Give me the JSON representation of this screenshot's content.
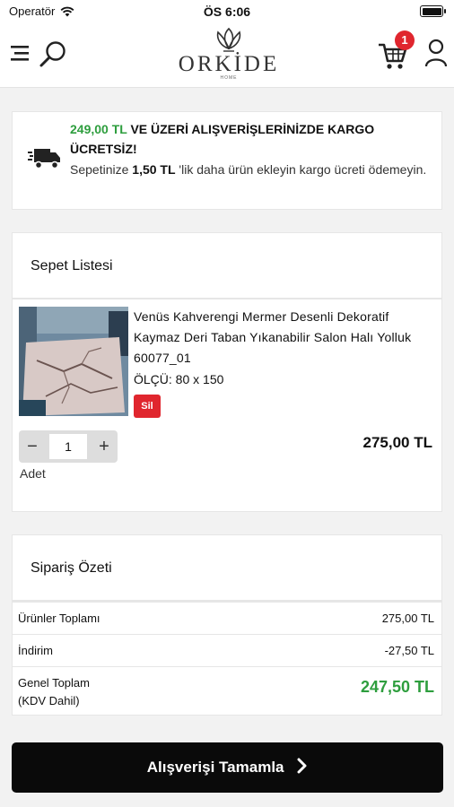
{
  "status_bar": {
    "carrier": "Operatör",
    "time": "ÖS 6:06"
  },
  "header": {
    "logo_text": "ORKİDE",
    "logo_subtext": "HOME",
    "cart_count": "1"
  },
  "shipping_banner": {
    "threshold": "249,00 TL",
    "title_rest": "VE ÜZERİ ALIŞVERİŞLERİNİZDE KARGO ÜCRETSİZ!",
    "message_prefix": "Sepetinize",
    "remaining_amount": "1,50 TL",
    "message_suffix": "'lik daha ürün ekleyin kargo ücreti ödemeyin."
  },
  "cart": {
    "title": "Sepet Listesi",
    "items": [
      {
        "name": "Venüs Kahverengi Mermer Desenli Dekoratif Kaymaz Deri Taban Yıkanabilir Salon Halı Yolluk 60077_01",
        "size": "ÖLÇÜ: 80 x 150",
        "remove_label": "Sil",
        "quantity": "1",
        "quantity_label": "Adet",
        "price": "275,00 TL"
      }
    ]
  },
  "summary": {
    "title": "Sipariş Özeti",
    "products_total_label": "Ürünler Toplamı",
    "products_total_value": "275,00 TL",
    "discount_label": "İndirim",
    "discount_value": "-27,50 TL",
    "grand_total_label_line1": "Genel Toplam",
    "grand_total_label_line2": "(KDV Dahil)",
    "grand_total_value": "247,50 TL"
  },
  "checkout": {
    "label": "Alışverişi Tamamla"
  },
  "colors": {
    "accent_green": "#2e9e3e",
    "badge_red": "#e0262e",
    "checkout_bg": "#0a0a0a"
  },
  "icons": [
    "wifi-icon",
    "battery-icon",
    "menu-icon",
    "search-icon",
    "cart-icon",
    "user-icon",
    "truck-icon",
    "chevron-right-icon"
  ]
}
